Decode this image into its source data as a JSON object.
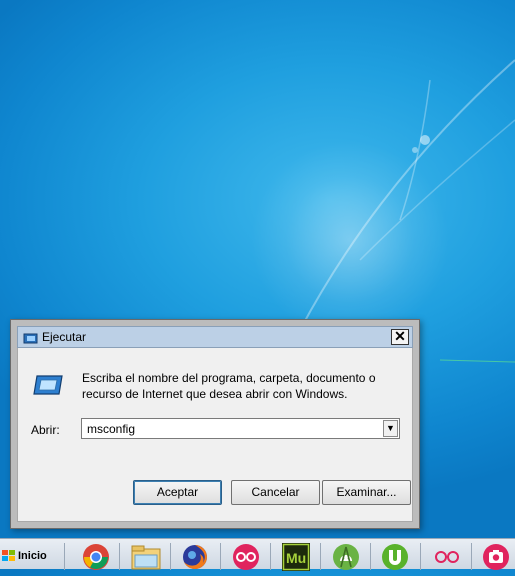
{
  "dialog": {
    "title": "Ejecutar",
    "close_glyph": "✕",
    "instructions": "Escriba el nombre del programa, carpeta, documento o recurso de Internet que desea abrir con Windows.",
    "open_label": "Abrir:",
    "open_value": "msconfig",
    "buttons": {
      "ok": "Aceptar",
      "cancel": "Cancelar",
      "browse": "Examinar..."
    }
  },
  "taskbar": {
    "start_label": "Inicio",
    "apps": [
      "chrome-icon",
      "file-explorer-icon",
      "firefox-icon",
      "flickr-icon",
      "adobe-muse-icon",
      "android-studio-icon",
      "utorrent-icon",
      "flickr-dots-icon",
      "camera-app-icon"
    ],
    "muse_text": "Mu"
  },
  "colors": {
    "desktop": "#1f9fdf",
    "titlebar": "#bcd0e6",
    "client": "#f0f0f0"
  }
}
